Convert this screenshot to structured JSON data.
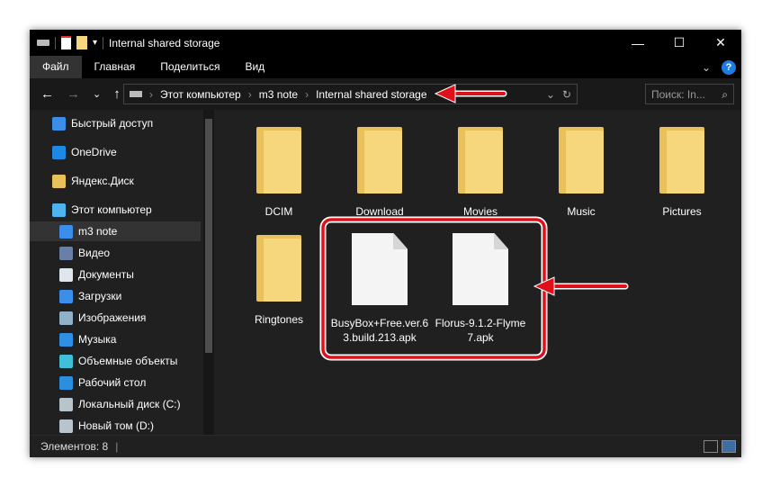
{
  "window": {
    "title": "Internal shared storage",
    "minimize": "—",
    "maximize": "☐",
    "close": "✕"
  },
  "ribbon": {
    "tabs": [
      "Файл",
      "Главная",
      "Поделиться",
      "Вид"
    ],
    "expand": "⌄",
    "help": "?"
  },
  "address": {
    "back": "←",
    "forward": "→",
    "recent": "⌄",
    "up": "↑",
    "crumbs": [
      "Этот компьютер",
      "m3 note",
      "Internal shared storage"
    ],
    "sep": "›",
    "dropdown": "⌄",
    "refresh": "↻",
    "search_placeholder": "Поиск: In...",
    "search_icon": "⌕"
  },
  "sidebar": {
    "items": [
      {
        "label": "Быстрый доступ",
        "icon": "star-icon",
        "color": "#3b8eea"
      },
      {
        "label": "OneDrive",
        "icon": "cloud-icon",
        "color": "#1e88e5"
      },
      {
        "label": "Яндекс.Диск",
        "icon": "yandex-disk-icon",
        "color": "#e8c15a"
      },
      {
        "label": "Этот компьютер",
        "icon": "computer-icon",
        "color": "#4fb3f0"
      },
      {
        "label": "m3 note",
        "icon": "phone-icon",
        "color": "#3b8eea"
      },
      {
        "label": "Видео",
        "icon": "video-icon",
        "color": "#6a7fa8"
      },
      {
        "label": "Документы",
        "icon": "document-icon",
        "color": "#dfe6ee"
      },
      {
        "label": "Загрузки",
        "icon": "download-icon",
        "color": "#3b8eea"
      },
      {
        "label": "Изображения",
        "icon": "pictures-icon",
        "color": "#8fb2c9"
      },
      {
        "label": "Музыка",
        "icon": "music-icon",
        "color": "#2f8fe6"
      },
      {
        "label": "Объемные объекты",
        "icon": "3d-objects-icon",
        "color": "#3fc0d8"
      },
      {
        "label": "Рабочий стол",
        "icon": "desktop-icon",
        "color": "#2b8fe0"
      },
      {
        "label": "Локальный диск (C:)",
        "icon": "drive-icon",
        "color": "#b8c4cc"
      },
      {
        "label": "Новый том (D:)",
        "icon": "drive-icon",
        "color": "#b8c4cc"
      }
    ]
  },
  "items": [
    {
      "name": "DCIM",
      "type": "folder"
    },
    {
      "name": "Download",
      "type": "folder"
    },
    {
      "name": "Movies",
      "type": "folder"
    },
    {
      "name": "Music",
      "type": "folder"
    },
    {
      "name": "Pictures",
      "type": "folder"
    },
    {
      "name": "Ringtones",
      "type": "folder"
    },
    {
      "name": "BusyBox+Free.ver.63.build.213.apk",
      "type": "file"
    },
    {
      "name": "Florus-9.1.2-Flyme7.apk",
      "type": "file"
    }
  ],
  "status": {
    "count": "Элементов: 8"
  },
  "colors": {
    "annotation": "#e0101a"
  }
}
